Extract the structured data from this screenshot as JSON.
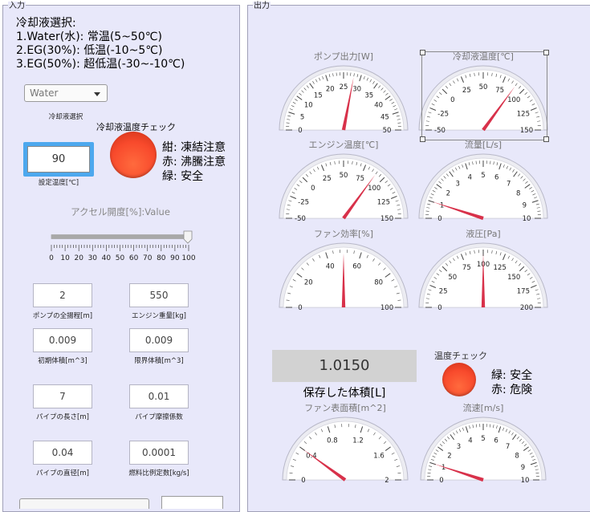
{
  "input_panel": {
    "title": "入力",
    "coolant_info": [
      "冷却液選択:",
      "1.Water(水): 常温(5~50℃)",
      "2.EG(30%): 低温(-10~5℃)",
      "3.EG(50%): 超低温(-30~-10℃)"
    ],
    "coolant_select": {
      "value": "Water",
      "label": "冷却液選択"
    },
    "temp_check": {
      "title": "冷却液温度チェック",
      "legend": [
        "紺: 凍結注意",
        "赤: 沸騰注意",
        "緑: 安全"
      ],
      "lamp_color": "#f84a2c"
    },
    "set_temp": {
      "value": "90",
      "label": "設定温度[℃]"
    },
    "accel": {
      "title": "アクセル開度[%]:Value",
      "value": 100,
      "ticks": [
        "0",
        "10",
        "20",
        "30",
        "40",
        "50",
        "60",
        "70",
        "80",
        "90",
        "100"
      ]
    },
    "fields": [
      {
        "value": "2",
        "label": "ポンプの全揚程[m]"
      },
      {
        "value": "550",
        "label": "エンジン重量[kg]"
      },
      {
        "value": "0.009",
        "label": "初期体積[m^3]"
      },
      {
        "value": "0.009",
        "label": "限界体積[m^3]"
      },
      {
        "value": "7",
        "label": "パイプの長さ[m]"
      },
      {
        "value": "0.01",
        "label": "パイプ摩擦係数"
      },
      {
        "value": "0.04",
        "label": "パイプの直径[m]"
      },
      {
        "value": "0.0001",
        "label": "燃料比例定数[kg/s]"
      }
    ]
  },
  "output_panel": {
    "title": "出力",
    "gauges": [
      {
        "title": "ポンプ出力[W]",
        "labels": [
          "0",
          "5",
          "10",
          "15",
          "20",
          "25",
          "30",
          "35",
          "40",
          "45",
          "50"
        ],
        "min": 0,
        "max": 50,
        "value": 28
      },
      {
        "title": "冷却液温度[℃]",
        "labels": [
          "-50",
          "-25",
          "0",
          "25",
          "50",
          "75",
          "100",
          "125",
          "150"
        ],
        "min": -50,
        "max": 150,
        "value": 90
      },
      {
        "title": "エンジン温度[℃]",
        "labels": [
          "-50",
          "-25",
          "0",
          "25",
          "50",
          "75",
          "100",
          "125",
          "150"
        ],
        "min": -50,
        "max": 150,
        "value": 90
      },
      {
        "title": "流量[L/s]",
        "labels": [
          "0",
          "1",
          "2",
          "3",
          "4",
          "5",
          "6",
          "7",
          "8",
          "9",
          "10"
        ],
        "min": 0,
        "max": 10,
        "value": 1.0
      },
      {
        "title": "ファン効率[%]",
        "labels": [
          "0",
          "20",
          "40",
          "60",
          "80",
          "100"
        ],
        "min": 0,
        "max": 100,
        "value": 50
      },
      {
        "title": "液圧[Pa]",
        "labels": [
          "0",
          "25",
          "50",
          "75",
          "100",
          "125",
          "150",
          "175",
          "200"
        ],
        "min": 0,
        "max": 200,
        "value": 100
      },
      {
        "title": "ファン表面積[m^2]",
        "labels": [
          "0",
          "0.4",
          "0.8",
          "1.2",
          "1.6",
          "2"
        ],
        "min": 0,
        "max": 2,
        "value": 0.4
      },
      {
        "title": "流速[m/s]",
        "labels": [
          "0",
          "1",
          "2",
          "3",
          "4",
          "5",
          "6",
          "7",
          "8",
          "9",
          "10"
        ],
        "min": 0,
        "max": 10,
        "value": 1.0
      }
    ],
    "volume": {
      "value": "1.0150",
      "label": "保存した体積[L]"
    },
    "temp_check": {
      "title": "温度チェック",
      "legend": [
        "緑: 安全",
        "赤: 危険"
      ],
      "lamp_color": "#f84a2c"
    }
  }
}
